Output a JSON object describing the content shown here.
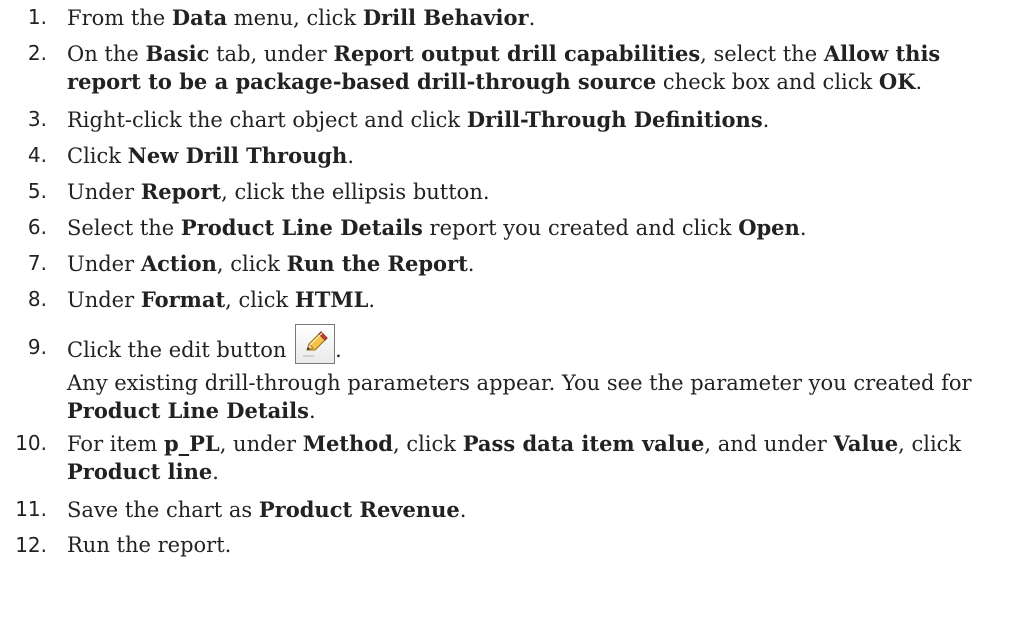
{
  "steps": [
    {
      "n": "1.",
      "parts": [
        [
          "t",
          "From the "
        ],
        [
          "b",
          "Data"
        ],
        [
          "t",
          " menu, click "
        ],
        [
          "b",
          "Drill Behavior"
        ],
        [
          "t",
          "."
        ]
      ]
    },
    {
      "n": "2.",
      "parts": [
        [
          "t",
          "On the "
        ],
        [
          "b",
          "Basic"
        ],
        [
          "t",
          " tab, under "
        ],
        [
          "b",
          "Report output drill capabilities"
        ],
        [
          "t",
          ", select the "
        ],
        [
          "b",
          "Allow this report to be a package-based drill-through source"
        ],
        [
          "t",
          " check box and click "
        ],
        [
          "b",
          "OK"
        ],
        [
          "t",
          "."
        ]
      ]
    },
    {
      "n": "3.",
      "parts": [
        [
          "t",
          "Right-click the chart object and click "
        ],
        [
          "b",
          "Drill-Through Definitions"
        ],
        [
          "t",
          "."
        ]
      ]
    },
    {
      "n": "4.",
      "parts": [
        [
          "t",
          "Click "
        ],
        [
          "b",
          "New Drill Through"
        ],
        [
          "t",
          "."
        ]
      ]
    },
    {
      "n": "5.",
      "parts": [
        [
          "t",
          "Under "
        ],
        [
          "b",
          "Report"
        ],
        [
          "t",
          ", click the ellipsis button."
        ]
      ]
    },
    {
      "n": "6.",
      "parts": [
        [
          "t",
          "Select the "
        ],
        [
          "b",
          "Product Line Details"
        ],
        [
          "t",
          " report you created and click "
        ],
        [
          "b",
          "Open"
        ],
        [
          "t",
          "."
        ]
      ]
    },
    {
      "n": "7.",
      "parts": [
        [
          "t",
          "Under "
        ],
        [
          "b",
          "Action"
        ],
        [
          "t",
          ", click "
        ],
        [
          "b",
          "Run the Report"
        ],
        [
          "t",
          "."
        ]
      ]
    },
    {
      "n": "8.",
      "parts": [
        [
          "t",
          "Under "
        ],
        [
          "b",
          "Format"
        ],
        [
          "t",
          ", click "
        ],
        [
          "b",
          "HTML"
        ],
        [
          "t",
          "."
        ]
      ]
    },
    {
      "n": "9.",
      "parts": [
        [
          "t",
          "Click the edit button "
        ],
        [
          "icon",
          "pencil-icon"
        ],
        [
          "t",
          "."
        ]
      ],
      "note": [
        [
          "t",
          "Any existing drill-through parameters appear. You see the parameter you created for "
        ],
        [
          "b",
          "Product Line Details"
        ],
        [
          "t",
          "."
        ]
      ]
    },
    {
      "n": "10.",
      "parts": [
        [
          "t",
          "For item "
        ],
        [
          "b",
          "p_PL"
        ],
        [
          "t",
          ", under "
        ],
        [
          "b",
          "Method"
        ],
        [
          "t",
          ", click "
        ],
        [
          "b",
          "Pass data item value"
        ],
        [
          "t",
          ", and under "
        ],
        [
          "b",
          "Value"
        ],
        [
          "t",
          ", click "
        ],
        [
          "b",
          "Product line"
        ],
        [
          "t",
          "."
        ]
      ]
    },
    {
      "n": "11.",
      "parts": [
        [
          "t",
          "Save the chart as "
        ],
        [
          "b",
          "Product Revenue"
        ],
        [
          "t",
          "."
        ]
      ]
    },
    {
      "n": "12.",
      "parts": [
        [
          "t",
          "Run the report."
        ]
      ]
    }
  ]
}
